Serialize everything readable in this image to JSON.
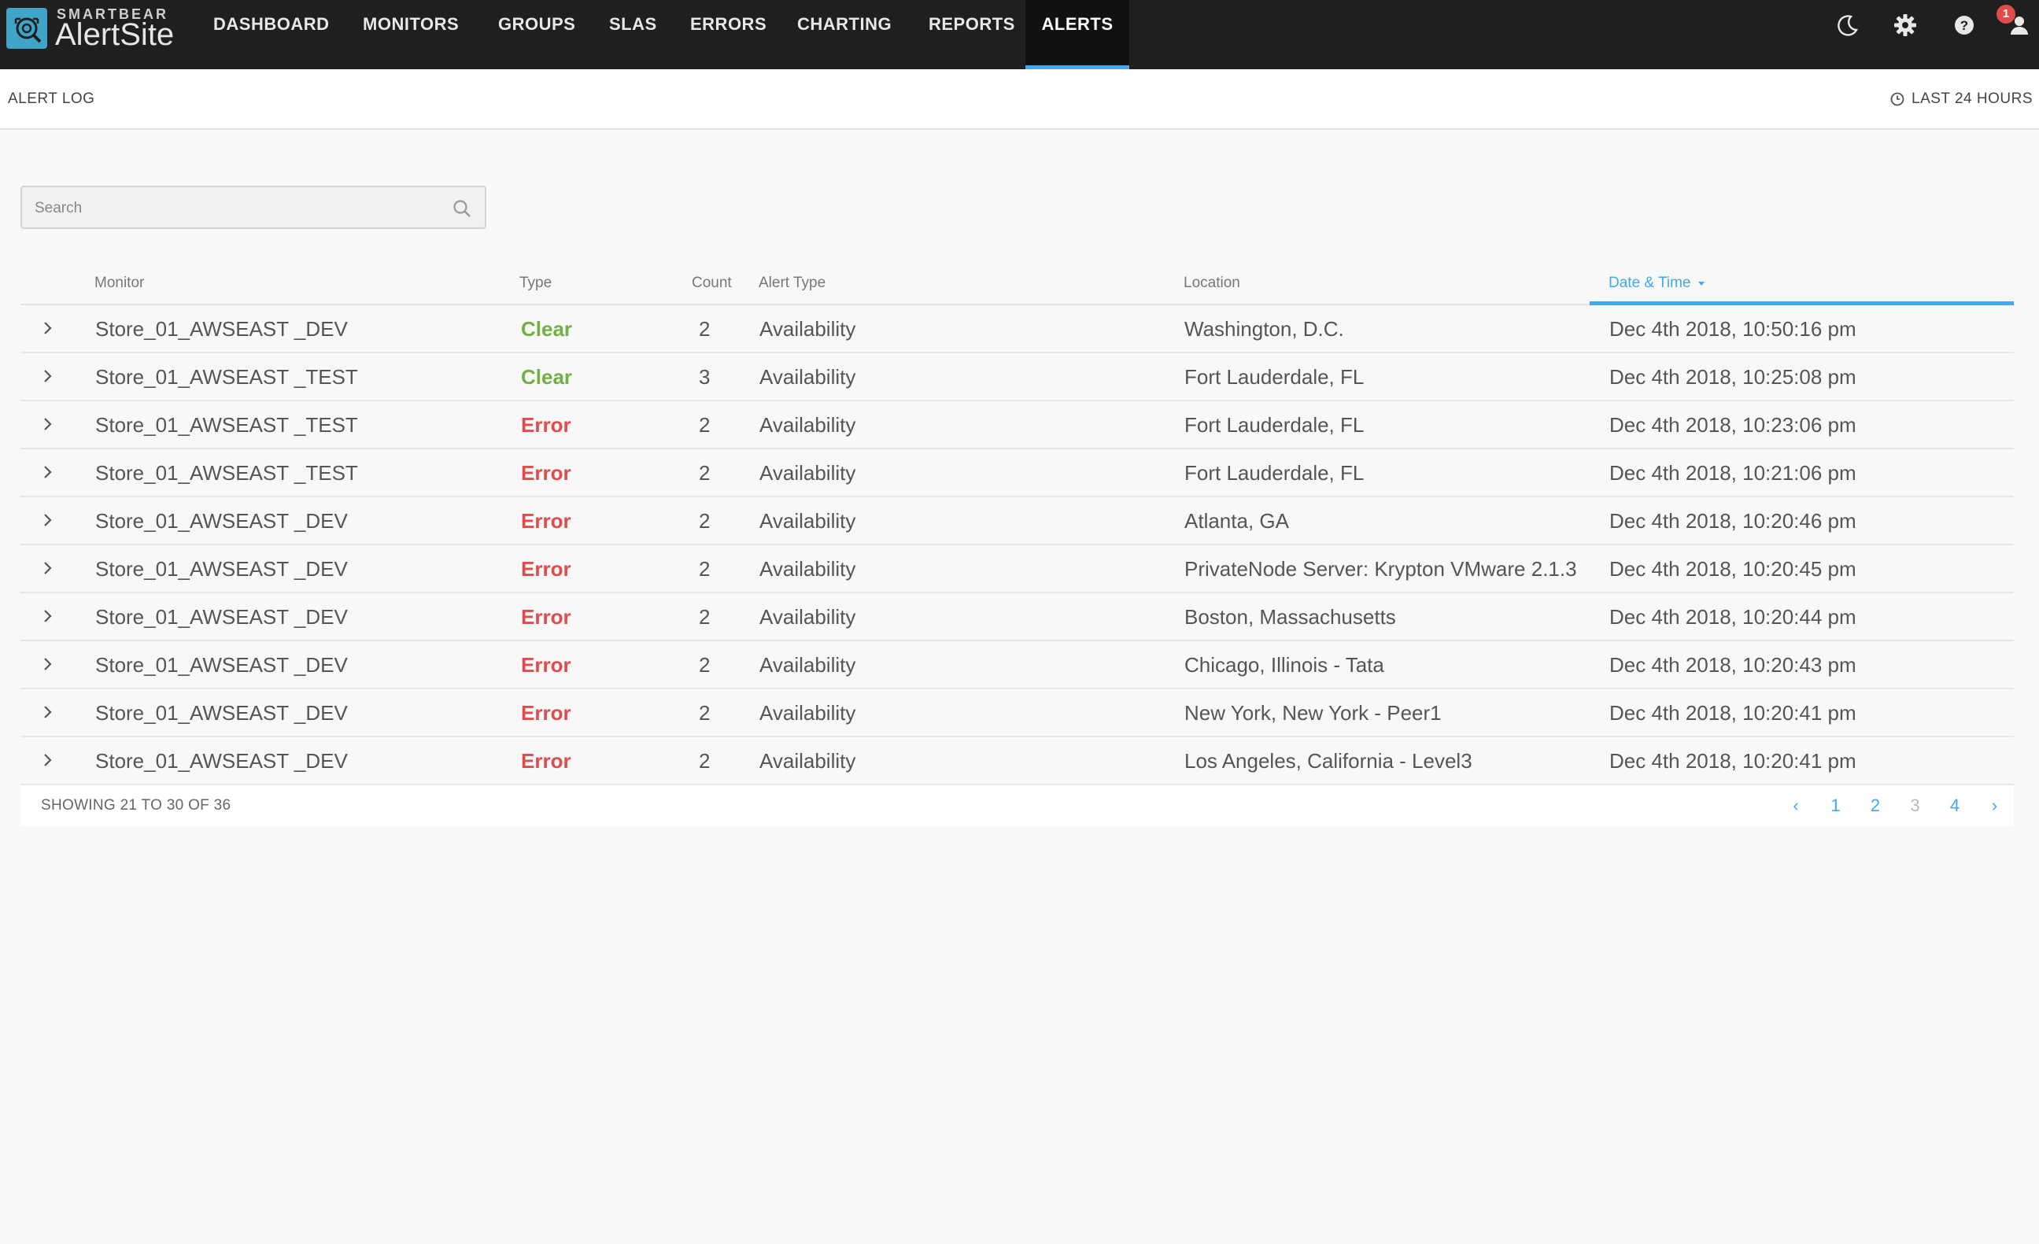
{
  "brand": {
    "company": "SMARTBEAR",
    "product": "AlertSite"
  },
  "nav": [
    {
      "label": "DASHBOARD",
      "key": "dashboard"
    },
    {
      "label": "MONITORS",
      "key": "monitors"
    },
    {
      "label": "GROUPS",
      "key": "groups"
    },
    {
      "label": "SLAS",
      "key": "slas"
    },
    {
      "label": "ERRORS",
      "key": "errors"
    },
    {
      "label": "CHARTING",
      "key": "charting"
    },
    {
      "label": "REPORTS",
      "key": "reports"
    },
    {
      "label": "ALERTS",
      "key": "alerts",
      "active": true
    }
  ],
  "top_icons": [
    "moon-icon",
    "gear-icon",
    "help-icon",
    "user-icon"
  ],
  "notification_count": "1",
  "subheader": {
    "title": "ALERT LOG",
    "time_range": "LAST 24 HOURS"
  },
  "search": {
    "placeholder": "Search",
    "value": ""
  },
  "table": {
    "columns": {
      "monitor": "Monitor",
      "type": "Type",
      "count": "Count",
      "alert_type": "Alert Type",
      "location": "Location",
      "datetime": "Date & Time"
    },
    "sorted_by": "datetime",
    "rows": [
      {
        "monitor": "Store_01_AWSEAST _DEV",
        "type": "Clear",
        "count": "2",
        "alert_type": "Availability",
        "location": "Washington, D.C.",
        "datetime": "Dec 4th 2018, 10:50:16 pm"
      },
      {
        "monitor": "Store_01_AWSEAST _TEST",
        "type": "Clear",
        "count": "3",
        "alert_type": "Availability",
        "location": "Fort Lauderdale, FL",
        "datetime": "Dec 4th 2018, 10:25:08 pm"
      },
      {
        "monitor": "Store_01_AWSEAST _TEST",
        "type": "Error",
        "count": "2",
        "alert_type": "Availability",
        "location": "Fort Lauderdale, FL",
        "datetime": "Dec 4th 2018, 10:23:06 pm"
      },
      {
        "monitor": "Store_01_AWSEAST _TEST",
        "type": "Error",
        "count": "2",
        "alert_type": "Availability",
        "location": "Fort Lauderdale, FL",
        "datetime": "Dec 4th 2018, 10:21:06 pm"
      },
      {
        "monitor": "Store_01_AWSEAST _DEV",
        "type": "Error",
        "count": "2",
        "alert_type": "Availability",
        "location": "Atlanta, GA",
        "datetime": "Dec 4th 2018, 10:20:46 pm"
      },
      {
        "monitor": "Store_01_AWSEAST _DEV",
        "type": "Error",
        "count": "2",
        "alert_type": "Availability",
        "location": "PrivateNode Server: Krypton VMware 2.1.3",
        "datetime": "Dec 4th 2018, 10:20:45 pm"
      },
      {
        "monitor": "Store_01_AWSEAST _DEV",
        "type": "Error",
        "count": "2",
        "alert_type": "Availability",
        "location": "Boston, Massachusetts",
        "datetime": "Dec 4th 2018, 10:20:44 pm"
      },
      {
        "monitor": "Store_01_AWSEAST _DEV",
        "type": "Error",
        "count": "2",
        "alert_type": "Availability",
        "location": "Chicago, Illinois - Tata",
        "datetime": "Dec 4th 2018, 10:20:43 pm"
      },
      {
        "monitor": "Store_01_AWSEAST _DEV",
        "type": "Error",
        "count": "2",
        "alert_type": "Availability",
        "location": "New York, New York - Peer1",
        "datetime": "Dec 4th 2018, 10:20:41 pm"
      },
      {
        "monitor": "Store_01_AWSEAST _DEV",
        "type": "Error",
        "count": "2",
        "alert_type": "Availability",
        "location": "Los Angeles, California - Level3",
        "datetime": "Dec 4th 2018, 10:20:41 pm"
      }
    ]
  },
  "footer": {
    "showing": "SHOWING 21 TO 30 OF 36",
    "pages": [
      "1",
      "2",
      "3",
      "4"
    ],
    "current_page": "3",
    "prev": "‹",
    "next": "›"
  },
  "colors": {
    "accent": "#3fa9f5",
    "clear": "#73b043",
    "error": "#e04b4b",
    "nav_bg": "#1f1f1f"
  }
}
